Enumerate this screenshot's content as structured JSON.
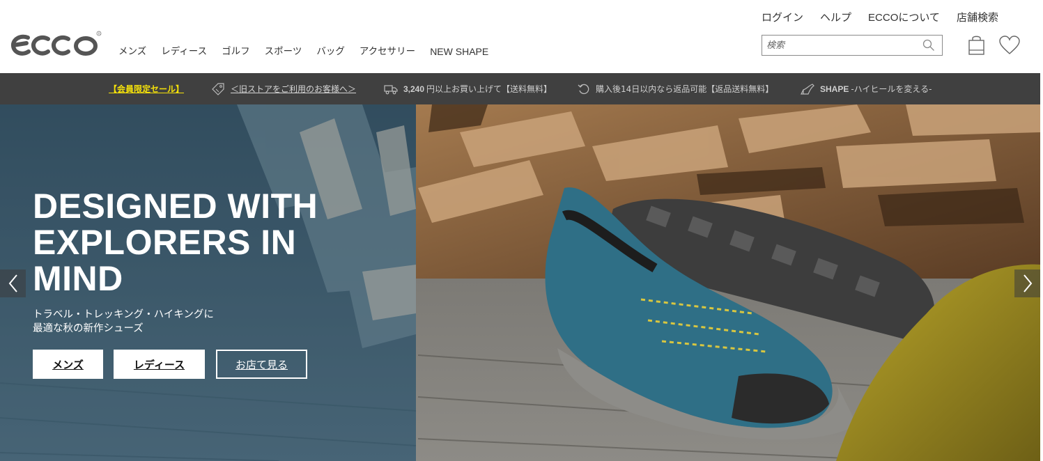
{
  "brand": {
    "logo_text": "ecco"
  },
  "main_nav": [
    "メンズ",
    "レディース",
    "ゴルフ",
    "スポーツ",
    "バッグ",
    "アクセサリー",
    "NEW SHAPE"
  ],
  "util_nav": {
    "login": "ログイン",
    "help": "ヘルプ",
    "about_prefix": "ECCO",
    "about_suffix": "について",
    "store": "店舗検索"
  },
  "search": {
    "placeholder": "検索"
  },
  "icons": {
    "search": "search-icon",
    "bag": "shopping-bag-icon",
    "wishlist": "heart-icon",
    "tag": "tag-icon",
    "truck": "truck-icon",
    "return": "return-icon",
    "shape": "heel-shoe-icon",
    "prev": "chevron-left-icon",
    "next": "chevron-right-icon"
  },
  "promo": {
    "member_sale": "【会員限定セール】",
    "old_store": "＜旧ストアをご利用のお客様へ＞",
    "shipping_amount": "3,240",
    "shipping_text": "円以上お買い上げて【送料無料】",
    "returns": "購入後14日以内なら返品可能【返品送料無料】",
    "shape_name": "SHAPE",
    "shape_text": " -ハイヒールを変える-"
  },
  "hero": {
    "title_line1": "DESIGNED WITH",
    "title_line2": "EXPLORERS IN",
    "title_line3": "MIND",
    "subtitle_line1": "トラベル・トレッキング・ハイキングに",
    "subtitle_line2": "最適な秋の新作シューズ",
    "btn_mens": "メンズ",
    "btn_ladies": "レディース",
    "btn_store": "お店て見る"
  },
  "colors": {
    "promo_bg": "#404040",
    "promo_highlight": "#f5e10a",
    "shoe_blue": "#2f6f86"
  }
}
